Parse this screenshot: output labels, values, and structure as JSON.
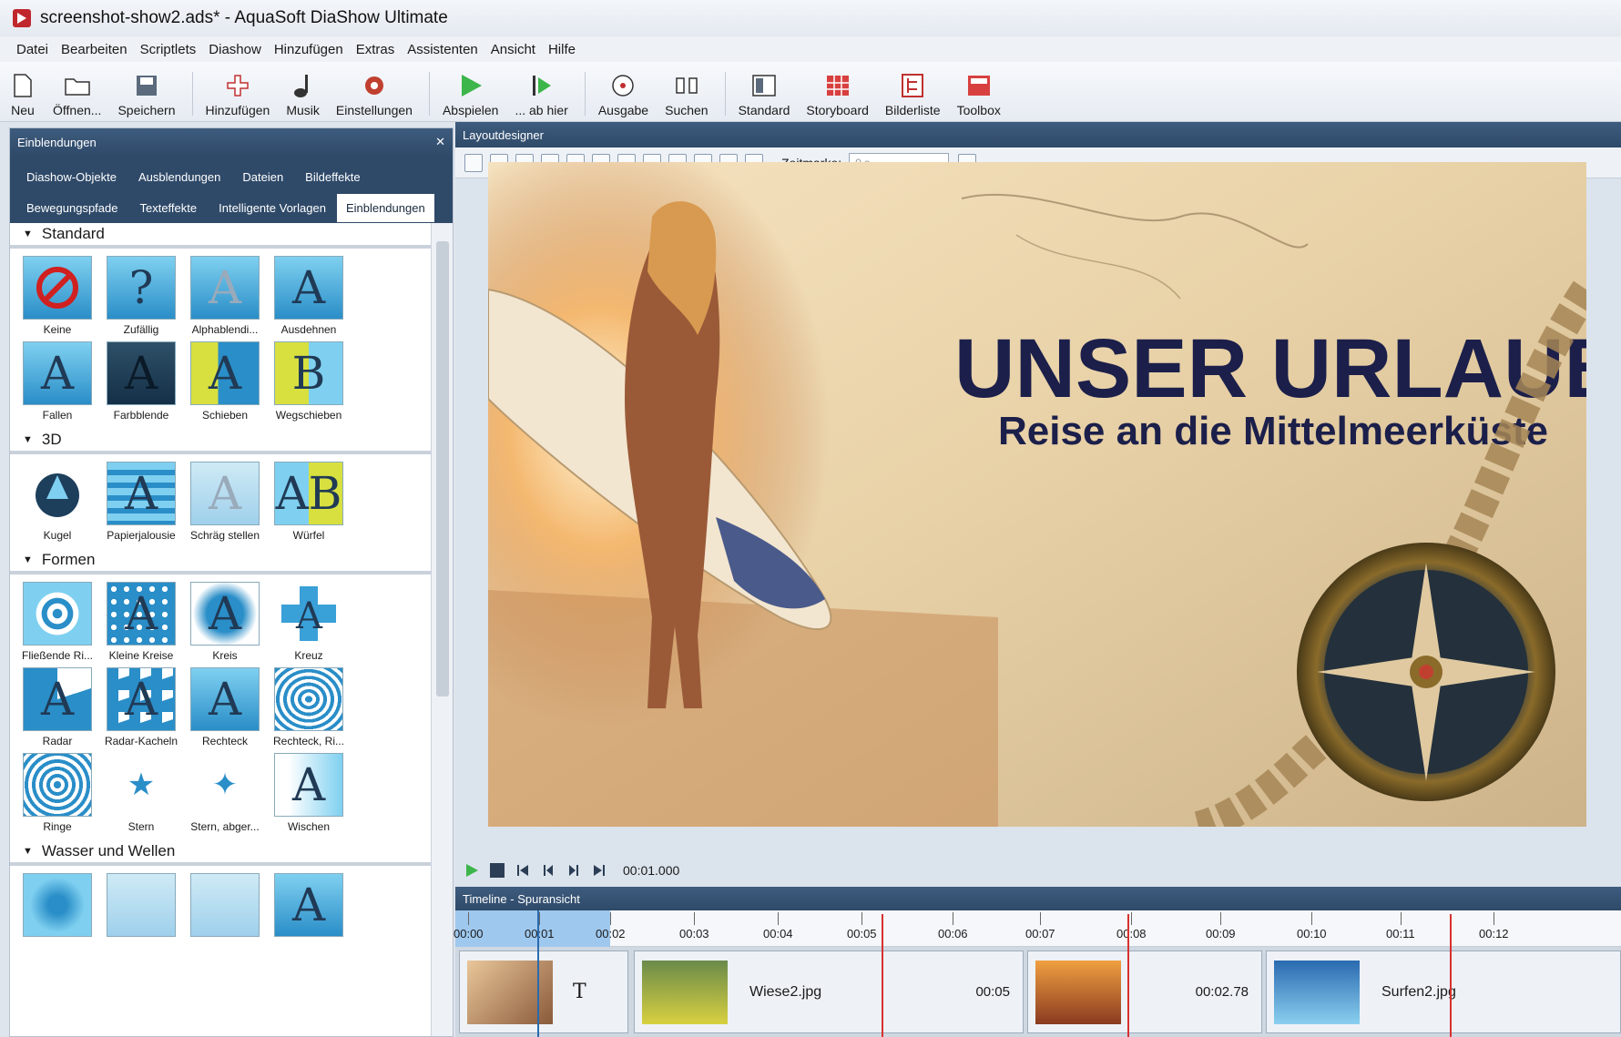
{
  "window": {
    "title": "screenshot-show2.ads* - AquaSoft DiaShow Ultimate"
  },
  "menu": [
    "Datei",
    "Bearbeiten",
    "Scriptlets",
    "Diashow",
    "Hinzufügen",
    "Extras",
    "Assistenten",
    "Ansicht",
    "Hilfe"
  ],
  "toolbar": {
    "neu": "Neu",
    "oeffnen": "Öffnen...",
    "speichern": "Speichern",
    "hinzufuegen": "Hinzufügen",
    "musik": "Musik",
    "einstellungen": "Einstellungen",
    "abspielen": "Abspielen",
    "abhier": "... ab hier",
    "ausgabe": "Ausgabe",
    "suchen": "Suchen",
    "standard": "Standard",
    "storyboard": "Storyboard",
    "bilderliste": "Bilderliste",
    "toolbox": "Toolbox"
  },
  "left_panel": {
    "title": "Einblendungen",
    "tabs_row1": [
      "Diashow-Objekte",
      "Ausblendungen",
      "Dateien",
      "Bildeffekte"
    ],
    "tabs_row2": [
      "Bewegungspfade",
      "Texteffekte",
      "Intelligente Vorlagen"
    ],
    "active_tab": "Einblendungen",
    "sections": [
      {
        "name": "Standard",
        "items": [
          "Keine",
          "Zufällig",
          "Alphablendi...",
          "Ausdehnen",
          "Fallen",
          "Farbblende",
          "Schieben",
          "Wegschieben"
        ]
      },
      {
        "name": "3D",
        "items": [
          "Kugel",
          "Papierjalousie",
          "Schräg stellen",
          "Würfel"
        ]
      },
      {
        "name": "Formen",
        "items": [
          "Fließende Ri...",
          "Kleine Kreise",
          "Kreis",
          "Kreuz",
          "Radar",
          "Radar-Kacheln",
          "Rechteck",
          "Rechteck, Ri...",
          "Ringe",
          "Stern",
          "Stern, abger...",
          "Wischen"
        ]
      },
      {
        "name": "Wasser und Wellen",
        "items": [
          "",
          "",
          "",
          ""
        ]
      }
    ]
  },
  "designer": {
    "title": "Layoutdesigner",
    "zeitmarke_label": "Zeitmarke:",
    "zeitmarke_value": "0 s",
    "headline": "UNSER URLAUB",
    "subline": "Reise an die Mittelmeerküste",
    "time": "00:01.000"
  },
  "timeline": {
    "title": "Timeline - Spuransicht",
    "ticks": [
      "00:00",
      "00:01",
      "00:02",
      "00:03",
      "00:04",
      "00:05",
      "00:06",
      "00:07",
      "00:08",
      "00:09",
      "00:10",
      "00:11",
      "00:12"
    ],
    "clips": [
      {
        "name": "",
        "duration": ""
      },
      {
        "name": "Wiese2.jpg",
        "duration": "00:05"
      },
      {
        "name": "",
        "duration": "00:02.78"
      },
      {
        "name": "Surfen2.jpg",
        "duration": ""
      }
    ]
  },
  "colors": {
    "panel_header": "#2f4a69",
    "accent": "#2a8ec8",
    "title_text": "#1b1f4a"
  }
}
